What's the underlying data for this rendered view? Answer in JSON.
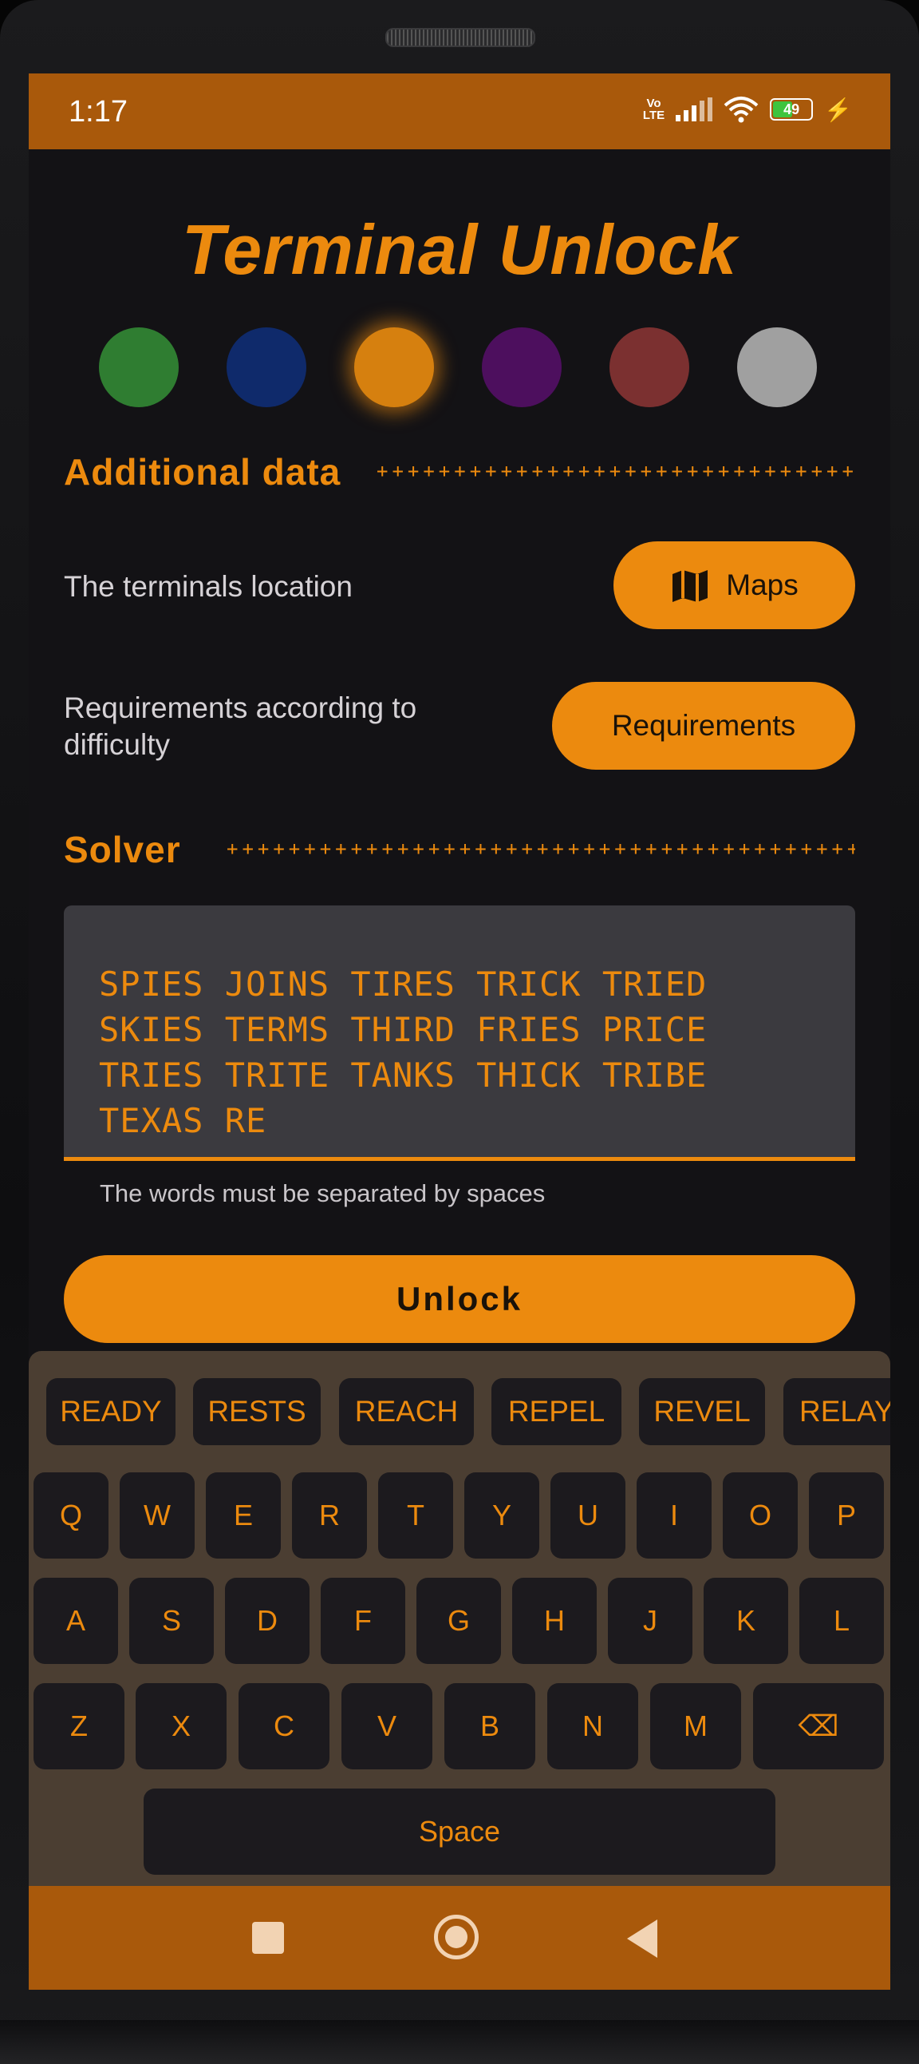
{
  "status_bar": {
    "time": "1:17",
    "volte": "Vo LTE",
    "battery": "49"
  },
  "app": {
    "title": "Terminal Unlock"
  },
  "colors": [
    {
      "name": "green",
      "hex": "#2f7d31",
      "selected": false
    },
    {
      "name": "blue",
      "hex": "#0f2a6b",
      "selected": false
    },
    {
      "name": "orange",
      "hex": "#d6800f",
      "selected": true
    },
    {
      "name": "purple",
      "hex": "#4d0f5e",
      "selected": false
    },
    {
      "name": "red",
      "hex": "#7b3030",
      "selected": false
    },
    {
      "name": "gray",
      "hex": "#a0a0a0",
      "selected": false
    }
  ],
  "additional": {
    "heading": "Additional data",
    "location_label": "The terminals location",
    "maps_button": "Maps",
    "requirements_label": "Requirements according to difficulty",
    "requirements_button": "Requirements"
  },
  "solver": {
    "heading": "Solver",
    "text": "SPIES JOINS TIRES TRICK TRIED\nSKIES TERMS THIRD FRIES PRICE\nTRIES TRITE TANKS THICK TRIBE\nTEXAS RE",
    "helper": "The words must be separated by spaces",
    "unlock_button": "Unlock"
  },
  "keyboard": {
    "suggestions": [
      "READY",
      "RESTS",
      "REACH",
      "REPEL",
      "REVEL",
      "RELAY"
    ],
    "row1": [
      "Q",
      "W",
      "E",
      "R",
      "T",
      "Y",
      "U",
      "I",
      "O",
      "P"
    ],
    "row2": [
      "A",
      "S",
      "D",
      "F",
      "G",
      "H",
      "J",
      "K",
      "L"
    ],
    "row3": [
      "Z",
      "X",
      "C",
      "V",
      "B",
      "N",
      "M"
    ],
    "backspace": "⌫",
    "space": "Space"
  },
  "accent_color": "#ec8a0e"
}
